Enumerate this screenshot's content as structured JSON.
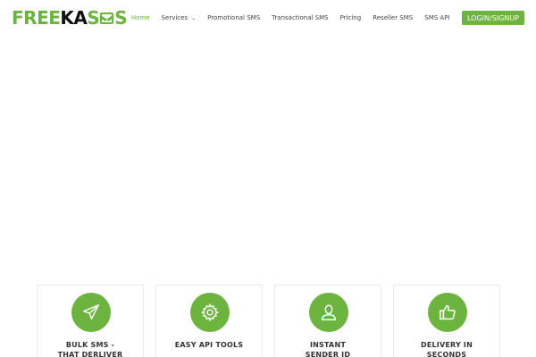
{
  "brand": {
    "logo_part1": "FREE",
    "logo_part2": "KA",
    "logo_part3": "S",
    "logo_part4": "S",
    "accent_color": "#6cb33f"
  },
  "nav": {
    "items": [
      {
        "label": "Home",
        "active": true
      },
      {
        "label": "Services",
        "has_dropdown": true
      },
      {
        "label": "Promotional SMS"
      },
      {
        "label": "Transactional SMS"
      },
      {
        "label": "Pricing"
      },
      {
        "label": "Reseller SMS"
      },
      {
        "label": "SMS API"
      }
    ],
    "login_label": "LOGIN/SIGNUP",
    "dropdown_icon": "chevron-down-icon"
  },
  "features": [
    {
      "title": "BULK SMS - THAT DERLIVER",
      "icon": "paper-plane-icon"
    },
    {
      "title": "EASY API TOOLS",
      "icon": "gear-icon"
    },
    {
      "title": "INSTANT SENDER ID",
      "icon": "user-icon"
    },
    {
      "title": "DELIVERY IN SECONDS",
      "icon": "thumbs-up-icon"
    }
  ]
}
